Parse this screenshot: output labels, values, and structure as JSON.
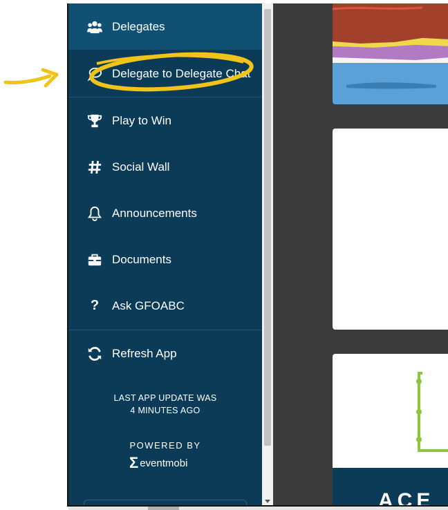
{
  "sidebar": {
    "items": [
      {
        "label": "Delegates",
        "icon": "users-icon"
      },
      {
        "label": "Delegate to Delegate Chat",
        "icon": "chat-bubble-icon"
      },
      {
        "label": "Play to Win",
        "icon": "trophy-icon"
      },
      {
        "label": "Social Wall",
        "icon": "hashtag-icon"
      },
      {
        "label": "Announcements",
        "icon": "bell-icon"
      },
      {
        "label": "Documents",
        "icon": "briefcase-icon"
      },
      {
        "label": "Ask GFOABC",
        "icon": "question-icon"
      },
      {
        "label": "Refresh App",
        "icon": "refresh-icon"
      }
    ],
    "update_line1": "LAST APP UPDATE WAS",
    "update_line2": "4 MINUTES AGO",
    "powered_by": "POWERED BY",
    "logo_text": "eventmobi"
  },
  "content": {
    "card3_text": "ACE"
  },
  "colors": {
    "sidebar_bg": "#0c3b57",
    "active_item_bg": "#0f5073",
    "annotation": "#f0c419"
  }
}
